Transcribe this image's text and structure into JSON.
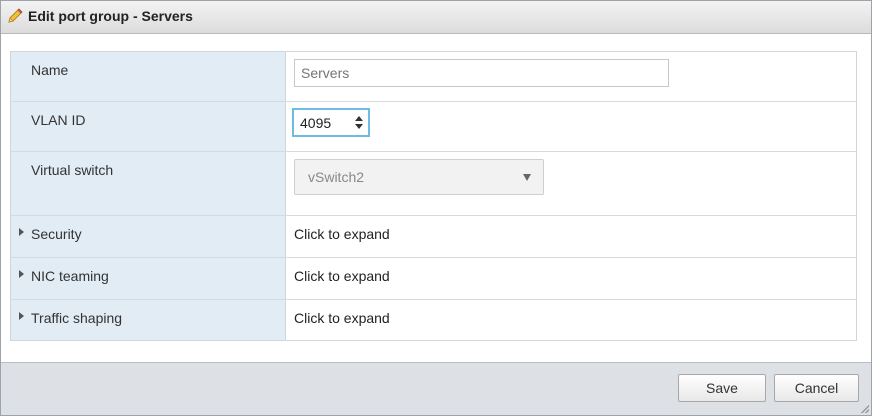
{
  "dialog": {
    "title": "Edit port group - Servers",
    "title_icon": "pencil-icon"
  },
  "form": {
    "name": {
      "label": "Name",
      "placeholder": "Servers",
      "value": ""
    },
    "vlan": {
      "label": "VLAN ID",
      "value": "4095"
    },
    "vswitch": {
      "label": "Virtual switch",
      "selected": "vSwitch2"
    },
    "security": {
      "label": "Security",
      "value": "Click to expand"
    },
    "nic_teaming": {
      "label": "NIC teaming",
      "value": "Click to expand"
    },
    "traffic_shaping": {
      "label": "Traffic shaping",
      "value": "Click to expand"
    }
  },
  "footer": {
    "save_label": "Save",
    "cancel_label": "Cancel"
  },
  "colors": {
    "label_bg": "#e1ecf5",
    "focus_border": "#6dbde3",
    "footer_bg": "#dde1e5"
  }
}
